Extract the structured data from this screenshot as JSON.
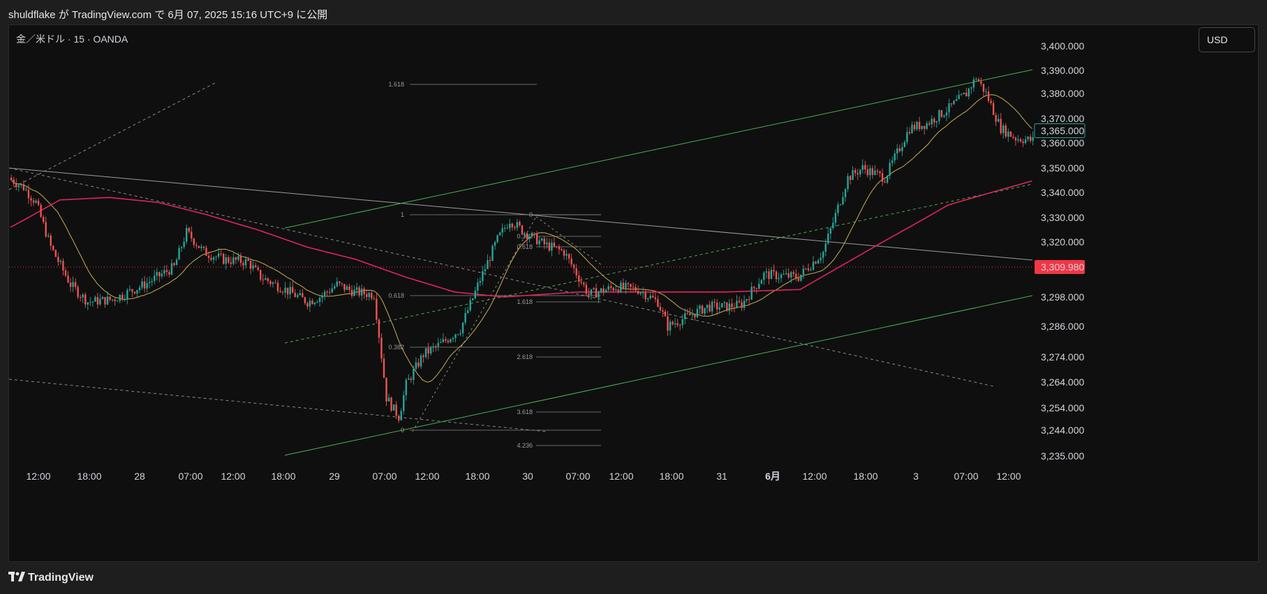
{
  "header": {
    "published_text": "shuldflake が TradingView.com で 6月 07, 2025 15:16 UTC+9 に公開"
  },
  "chart_header": {
    "symbol_text": "金／米ドル · 15 · OANDA",
    "currency_button": "USD"
  },
  "footer": {
    "brand": "TradingView"
  },
  "colors": {
    "background": "#0f0f0f",
    "up_candle": "#26a69a",
    "down_candle": "#ef5350",
    "ma_fast": "#b7a24a",
    "ma_slow": "#e0245e",
    "channel": "#4caf50",
    "price_label_red": "#f23645",
    "price_label_green": "#26a69a"
  },
  "chart_data": {
    "type": "candlestick",
    "symbol": "XAU/USD",
    "interval": "15",
    "source": "OANDA",
    "y_axis": {
      "ticks": [
        "3,235.000",
        "3,244.000",
        "3,254.000",
        "3,264.000",
        "3,274.000",
        "3,286.000",
        "3,298.000",
        "3,320.000",
        "3,330.000",
        "3,340.000",
        "3,350.000",
        "3,360.000",
        "3,370.000",
        "3,380.000",
        "3,390.000",
        "3,400.000"
      ],
      "tick_values": [
        3235,
        3244,
        3254,
        3264,
        3274,
        3286,
        3298,
        3320,
        3330,
        3340,
        3350,
        3360,
        3370,
        3380,
        3390,
        3400
      ]
    },
    "x_axis": {
      "labels": [
        "12:00",
        "18:00",
        "28",
        "07:00",
        "12:00",
        "18:00",
        "29",
        "07:00",
        "12:00",
        "18:00",
        "30",
        "07:00",
        "12:00",
        "18:00",
        "31",
        "6月",
        "12:00",
        "18:00",
        "3",
        "07:00",
        "12:00"
      ],
      "bold_labels": [
        "6月"
      ]
    },
    "price_labels": [
      {
        "text": "3,365.000",
        "value": 3365,
        "style": "green-outline"
      },
      {
        "text": "3,309.980",
        "value": 3309.98,
        "style": "red-fill"
      }
    ],
    "horizontal_line": {
      "value": 3309.98,
      "style": "dotted",
      "color": "#f23645"
    },
    "price_path": [
      [
        0,
        3346
      ],
      [
        6,
        3342
      ],
      [
        11,
        3336
      ],
      [
        17,
        3318
      ],
      [
        25,
        3303
      ],
      [
        32,
        3296
      ],
      [
        42,
        3297
      ],
      [
        55,
        3303
      ],
      [
        67,
        3310
      ],
      [
        72,
        3324
      ],
      [
        79,
        3316
      ],
      [
        87,
        3313
      ],
      [
        97,
        3312
      ],
      [
        102,
        3306
      ],
      [
        112,
        3301
      ],
      [
        121,
        3296
      ],
      [
        126,
        3298
      ],
      [
        133,
        3303
      ],
      [
        140,
        3300
      ],
      [
        148,
        3299
      ],
      [
        153,
        3258
      ],
      [
        158,
        3250
      ],
      [
        161,
        3263
      ],
      [
        168,
        3275
      ],
      [
        175,
        3279
      ],
      [
        183,
        3285
      ],
      [
        191,
        3305
      ],
      [
        198,
        3321
      ],
      [
        203,
        3329
      ],
      [
        209,
        3324
      ],
      [
        217,
        3319
      ],
      [
        225,
        3316
      ],
      [
        235,
        3299
      ],
      [
        246,
        3302
      ],
      [
        255,
        3301
      ],
      [
        263,
        3296
      ],
      [
        267,
        3286
      ],
      [
        273,
        3289
      ],
      [
        283,
        3294
      ],
      [
        291,
        3294
      ],
      [
        297,
        3295
      ],
      [
        306,
        3307
      ],
      [
        320,
        3306
      ],
      [
        330,
        3316
      ],
      [
        340,
        3346
      ],
      [
        346,
        3350
      ],
      [
        355,
        3346
      ],
      [
        365,
        3366
      ],
      [
        372,
        3368
      ],
      [
        381,
        3374
      ],
      [
        388,
        3380
      ],
      [
        392,
        3387
      ],
      [
        396,
        3380
      ],
      [
        402,
        3366
      ],
      [
        408,
        3362
      ],
      [
        415,
        3361
      ]
    ],
    "moving_averages": [
      {
        "name": "MA fast",
        "color": "#b7a24a"
      },
      {
        "name": "MA slow",
        "color": "#e0245e"
      }
    ],
    "fibonacci_levels_1": [
      "1.618",
      "1",
      "0.618",
      "0.382",
      "0"
    ],
    "fibonacci_levels_2": [
      "0",
      "0.382",
      "0.618",
      "1.618",
      "2.618",
      "3.618",
      "4.236"
    ],
    "grid": false
  }
}
